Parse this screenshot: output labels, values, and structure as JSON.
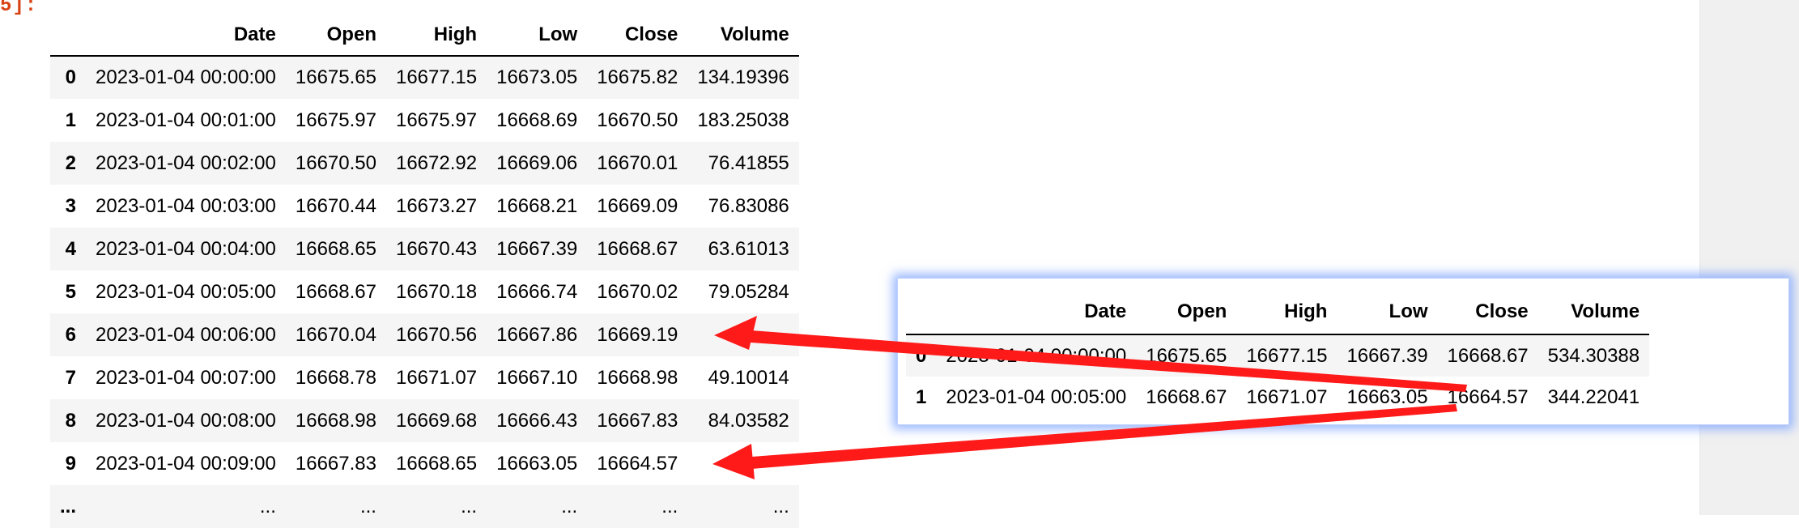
{
  "cell_prompt": "5]:",
  "main_table": {
    "columns": [
      "",
      "Date",
      "Open",
      "High",
      "Low",
      "Close",
      "Volume"
    ],
    "rows": [
      [
        "0",
        "2023-01-04 00:00:00",
        "16675.65",
        "16677.15",
        "16673.05",
        "16675.82",
        "134.19396"
      ],
      [
        "1",
        "2023-01-04 00:01:00",
        "16675.97",
        "16675.97",
        "16668.69",
        "16670.50",
        "183.25038"
      ],
      [
        "2",
        "2023-01-04 00:02:00",
        "16670.50",
        "16672.92",
        "16669.06",
        "16670.01",
        "76.41855"
      ],
      [
        "3",
        "2023-01-04 00:03:00",
        "16670.44",
        "16673.27",
        "16668.21",
        "16669.09",
        "76.83086"
      ],
      [
        "4",
        "2023-01-04 00:04:00",
        "16668.65",
        "16670.43",
        "16667.39",
        "16668.67",
        "63.61013"
      ],
      [
        "5",
        "2023-01-04 00:05:00",
        "16668.67",
        "16670.18",
        "16666.74",
        "16670.02",
        "79.05284"
      ],
      [
        "6",
        "2023-01-04 00:06:00",
        "16670.04",
        "16670.56",
        "16667.86",
        "16669.19",
        ""
      ],
      [
        "7",
        "2023-01-04 00:07:00",
        "16668.78",
        "16671.07",
        "16667.10",
        "16668.98",
        "49.10014"
      ],
      [
        "8",
        "2023-01-04 00:08:00",
        "16668.98",
        "16669.68",
        "16666.43",
        "16667.83",
        "84.03582"
      ],
      [
        "9",
        "2023-01-04 00:09:00",
        "16667.83",
        "16668.65",
        "16663.05",
        "16664.57",
        ""
      ],
      [
        "...",
        "...",
        "...",
        "...",
        "...",
        "...",
        "..."
      ]
    ]
  },
  "zoom_table": {
    "columns": [
      "",
      "Date",
      "Open",
      "High",
      "Low",
      "Close",
      "Volume"
    ],
    "rows": [
      [
        "0",
        "2023-01-04 00:00:00",
        "16675.65",
        "16677.15",
        "16667.39",
        "16668.67",
        "534.30388"
      ],
      [
        "1",
        "2023-01-04 00:05:00",
        "16668.67",
        "16671.07",
        "16663.05",
        "16664.57",
        "344.22041"
      ]
    ]
  },
  "colors": {
    "arrow": "#ff1a1a",
    "card_glow": "#8fb0ff",
    "row_stripe": "#f5f5f5"
  }
}
